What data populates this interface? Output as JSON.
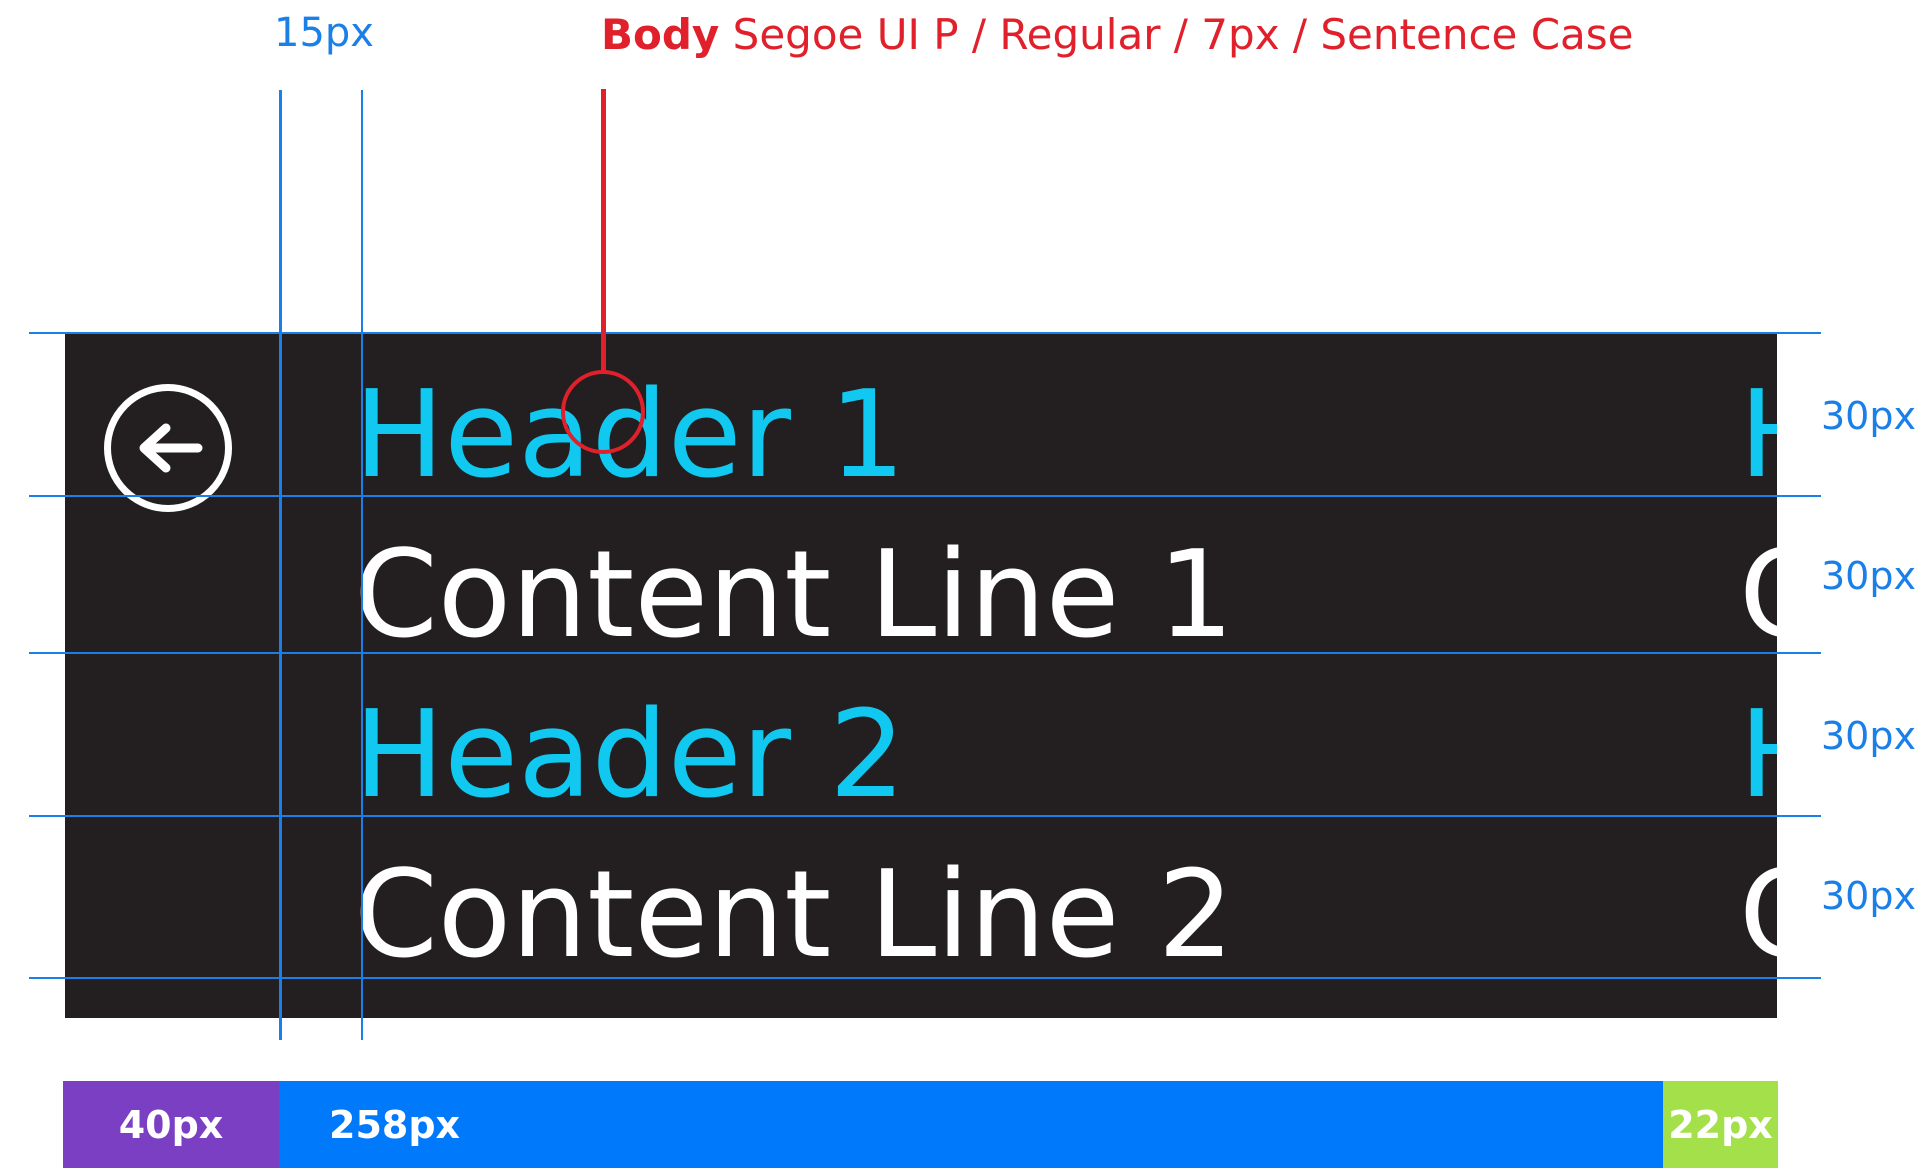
{
  "annotations": {
    "left_spacing": "15px",
    "body_label": "Body",
    "body_spec": " Segoe UI P / Regular / 7px / Sentence Case",
    "row_spacings": [
      "30px",
      "30px",
      "30px",
      "30px"
    ]
  },
  "panel": {
    "rows": [
      {
        "text": "Header 1",
        "kind": "header",
        "clip": "H"
      },
      {
        "text": "Content Line 1",
        "kind": "content",
        "clip": "C"
      },
      {
        "text": "Header 2",
        "kind": "header",
        "clip": "H"
      },
      {
        "text": "Content Line 2",
        "kind": "content",
        "clip": "C"
      }
    ],
    "back_icon": "arrow-left-circle-icon"
  },
  "width_bar": {
    "left_label": "40px",
    "middle_label": "258px",
    "right_label": "22px"
  },
  "colors": {
    "guide": "#1a7fe6",
    "annotation": "#e0202a",
    "panel_bg": "#231f20",
    "header_text": "#10c8f0",
    "content_text": "#ffffff",
    "bar_left": "#7b3fc4",
    "bar_mid": "#0079fb",
    "bar_right": "#a4e04a"
  }
}
